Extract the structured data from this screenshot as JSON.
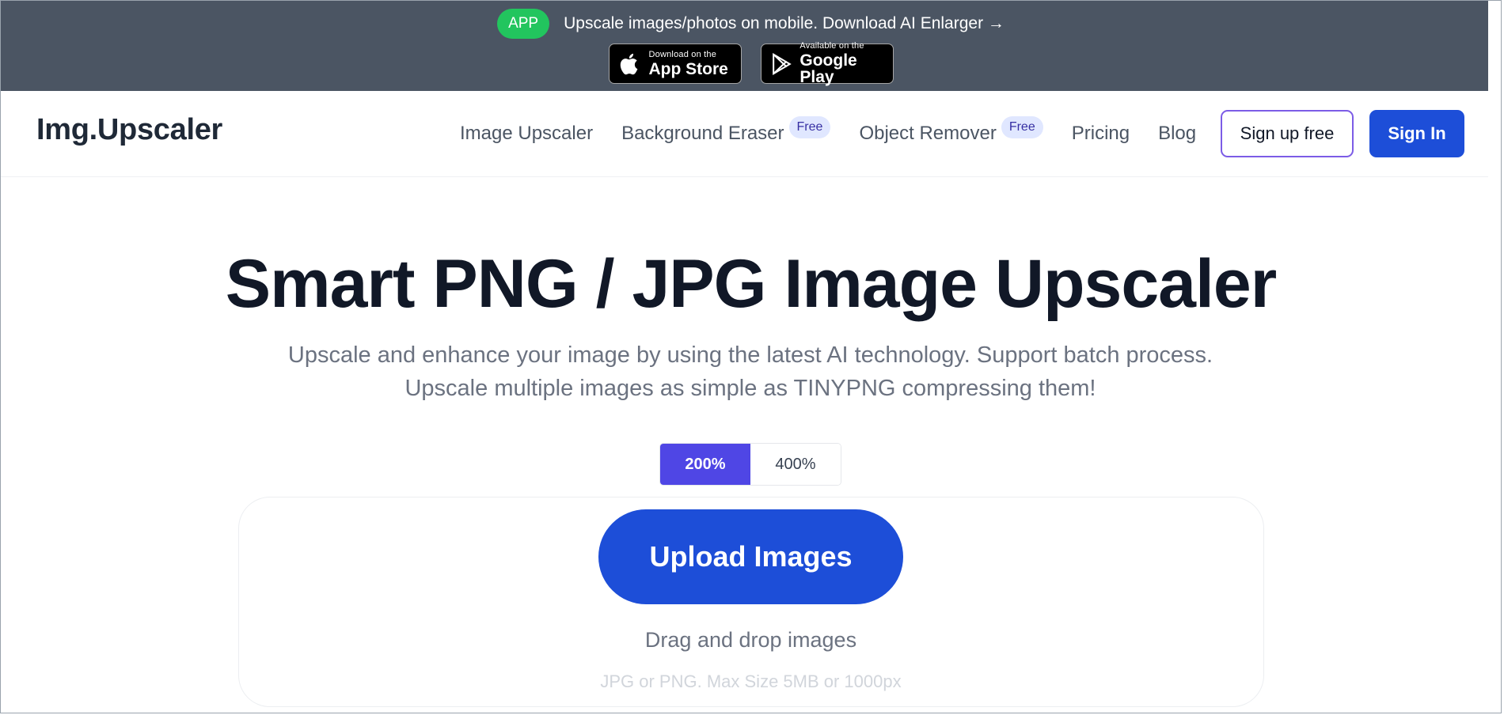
{
  "promo": {
    "badge": "APP",
    "text": "Upscale images/photos on mobile. Download AI Enlarger →",
    "app_store": {
      "small": "Download on the",
      "big": "App Store",
      "icon": "apple-icon"
    },
    "google_play": {
      "small": "Available on the",
      "big": "Google Play",
      "icon": "play-icon"
    }
  },
  "nav": {
    "logo": "Img.Upscaler",
    "links": [
      {
        "label": "Image Upscaler"
      },
      {
        "label": "Background Eraser",
        "badge": "Free"
      },
      {
        "label": "Object Remover",
        "badge": "Free"
      },
      {
        "label": "Pricing"
      },
      {
        "label": "Blog"
      }
    ],
    "signup": "Sign up free",
    "signin": "Sign In"
  },
  "hero": {
    "title": "Smart PNG / JPG Image Upscaler",
    "subtitle": "Upscale and enhance your image by using the latest AI technology. Support batch process. Upscale multiple images as simple as TINYPNG compressing them!"
  },
  "scale": {
    "options": [
      "200%",
      "400%"
    ],
    "selected": "200%"
  },
  "upload": {
    "button": "Upload Images",
    "drag_text": "Drag and drop images",
    "limits": "JPG or PNG. Max Size 5MB or 1000px"
  },
  "colors": {
    "primary": "#1d4ed8",
    "toggle_active": "#4f46e5",
    "banner_bg": "#4b5563",
    "app_badge": "#22c55e"
  }
}
